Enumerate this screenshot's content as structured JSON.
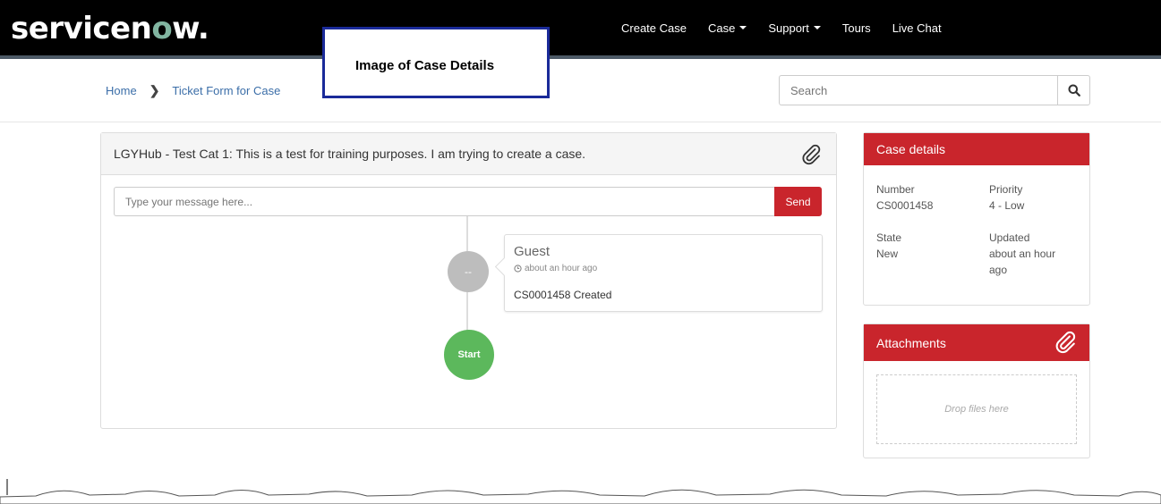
{
  "header": {
    "logo_text_pre": "servicen",
    "logo_text_o": "o",
    "logo_text_post": "w.",
    "nav": [
      {
        "label": "Create Case",
        "dropdown": false
      },
      {
        "label": "Case",
        "dropdown": true
      },
      {
        "label": "Support",
        "dropdown": true
      },
      {
        "label": "Tours",
        "dropdown": false
      },
      {
        "label": "Live Chat",
        "dropdown": false
      }
    ]
  },
  "callout": {
    "text": "Image of Case Details"
  },
  "breadcrumb": {
    "home": "Home",
    "current": "Ticket Form for Case"
  },
  "search": {
    "placeholder": "Search"
  },
  "case_panel": {
    "title": "LGYHub - Test Cat 1: This is a test for training purposes. I am trying to create a case.",
    "message_placeholder": "Type your message here...",
    "send_label": "Send"
  },
  "timeline": {
    "entry_author": "Guest",
    "entry_avatar_text": "--",
    "entry_time": "about an hour ago",
    "entry_text": "CS0001458 Created",
    "start_label": "Start"
  },
  "case_details": {
    "title": "Case details",
    "number_label": "Number",
    "number_value": "CS0001458",
    "priority_label": "Priority",
    "priority_value": "4 - Low",
    "state_label": "State",
    "state_value": "New",
    "updated_label": "Updated",
    "updated_value_line1": "about an hour",
    "updated_value_line2": "ago"
  },
  "attachments": {
    "title": "Attachments",
    "drop_text": "Drop files here"
  },
  "colors": {
    "brand_red": "#c9252c",
    "start_green": "#5cb85c",
    "topbar": "#000000"
  }
}
